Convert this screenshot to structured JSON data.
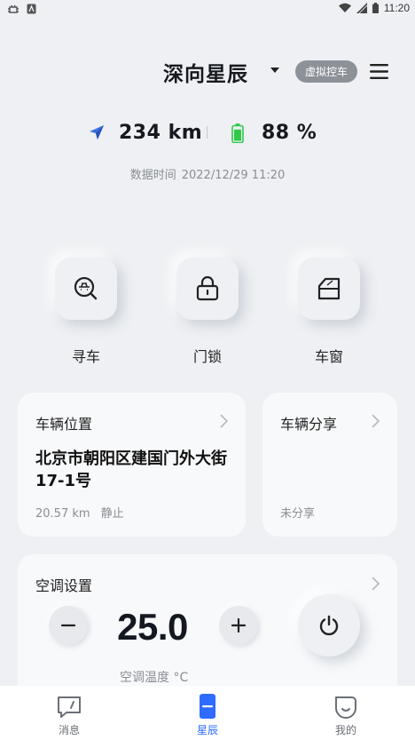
{
  "status_bar": {
    "time": "11:20"
  },
  "header": {
    "car_name": "深向星辰",
    "virtual_control_label": "虚拟控车"
  },
  "stats": {
    "range": "234 km",
    "battery": "88 %",
    "battery_level": 0.88,
    "data_time_label": "数据时间",
    "data_time_value": "2022/12/29 11:20"
  },
  "quick_actions": [
    {
      "label": "寻车",
      "icon": "find-car-icon"
    },
    {
      "label": "门锁",
      "icon": "lock-icon"
    },
    {
      "label": "车窗",
      "icon": "window-icon"
    }
  ],
  "location_card": {
    "title": "车辆位置",
    "address": "北京市朝阳区建国门外大街17-1号",
    "distance": "20.57 km",
    "state": "静止"
  },
  "share_card": {
    "title": "车辆分享",
    "status": "未分享"
  },
  "climate": {
    "title": "空调设置",
    "temperature": "25.0",
    "temperature_label": "空调温度 °C"
  },
  "bottom_nav": [
    {
      "label": "消息",
      "icon": "message-icon",
      "active": false
    },
    {
      "label": "星辰",
      "icon": "car-icon",
      "active": true
    },
    {
      "label": "我的",
      "icon": "profile-icon",
      "active": false
    }
  ],
  "colors": {
    "accent": "#2f6bff",
    "battery_green": "#2fc94a",
    "background": "#eef0f3",
    "card": "#f8f9fb"
  }
}
